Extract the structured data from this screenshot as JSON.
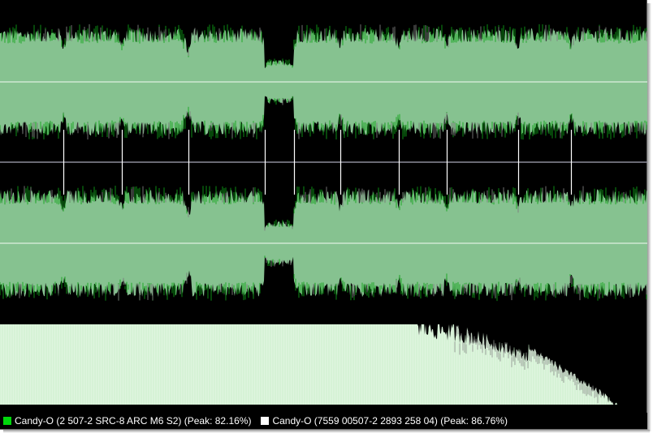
{
  "colors": {
    "background": "#000000",
    "wave_fill": "#86c290",
    "wave_bright": "#0ea318",
    "wave_dim": "#7d7d7d",
    "center_line": "#cfe8d2",
    "divider": "#8c8c99",
    "marker": "#ffffff",
    "spectrum_fill": "#dff5df",
    "spectrum_lines": "#b8e6b8"
  },
  "track_markers_fraction": [
    0.098,
    0.188,
    0.291,
    0.409,
    0.454,
    0.526,
    0.616,
    0.69,
    0.8,
    0.882
  ],
  "legend": [
    {
      "label": "Candy-O (2 507-2 SRC-8 ARC M6 S2) (Peak: 82.16%)",
      "swatch": "#00d80c"
    },
    {
      "label": "Candy-O (7559 00507-2 2893 258 04) (Peak: 86.76%)",
      "swatch": "#ffffff"
    }
  ]
}
